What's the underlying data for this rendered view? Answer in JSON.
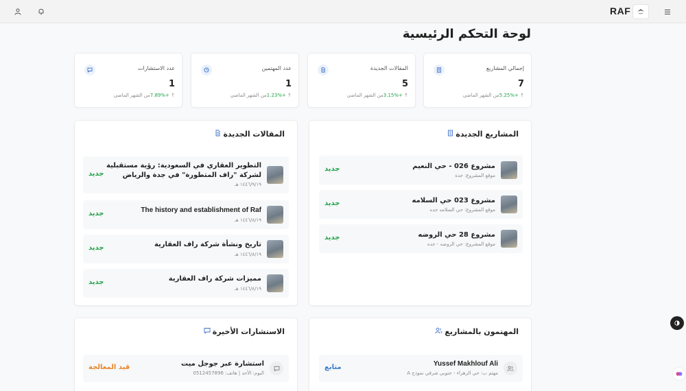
{
  "header": {
    "brand": "RAF",
    "menu_icon": "hamburger-icon",
    "bell_icon": "bell-icon",
    "user_icon": "user-icon"
  },
  "page_title": "لوحة التحكم الرئيسية",
  "stats": [
    {
      "label": "إجمالي المشاريع",
      "value": "7",
      "change": "+5.25%",
      "suffix": "من الشهر الماضي",
      "icon": "building-icon"
    },
    {
      "label": "المقالات الجديدة",
      "value": "5",
      "change": "+3.15%",
      "suffix": "من الشهر الماضي",
      "icon": "document-icon"
    },
    {
      "label": "عدد المهتمين",
      "value": "1",
      "change": "+1.23%",
      "suffix": "من الشهر الماضي",
      "icon": "clock-icon"
    },
    {
      "label": "عدد الاستشارات",
      "value": "1",
      "change": "+7.89%",
      "suffix": "من الشهر الماضي",
      "icon": "chat-icon"
    }
  ],
  "projects": {
    "title": "المشاريع الجديدة",
    "items": [
      {
        "title": "مشروع 026 - حي النعيم",
        "sub": "موقع المشروع: جدة",
        "tag": "جديد"
      },
      {
        "title": "مشروع 023 حي السلامه",
        "sub": "موقع المشروع: حي السلامه جده",
        "tag": "جديد"
      },
      {
        "title": "مشروع 28 حي الروضه",
        "sub": "موقع المشروع: حي الروضه - جده",
        "tag": "جديد"
      }
    ]
  },
  "articles": {
    "title": "المقالات الجديدة",
    "items": [
      {
        "title": "التطوير العقاري في السعودية: رؤية مستقبلية لشركة \"راف المتطورة\" في جدة والرياض",
        "sub": "١٤٤٦/٩/١٩ هـ",
        "tag": "جديد"
      },
      {
        "title": "The history and establishment of Raf",
        "sub": "١٤٤٦/٨/١٩ هـ",
        "tag": "جديد"
      },
      {
        "title": "تاريخ ونشأة شركة راف العقارية",
        "sub": "١٤٤٦/٨/١٩ هـ",
        "tag": "جديد"
      },
      {
        "title": "مميزات شركة راف العقارية",
        "sub": "١٤٤٦/٨/١٩ هـ",
        "tag": "جديد"
      }
    ]
  },
  "interested": {
    "title": "المهتمون بالمشاريع",
    "items": [
      {
        "name": "Yussef Makhlouf Ali",
        "sub": "مهتم ب: حي الزهراء - جنوبي شرقي نموذج A",
        "tag": "متابع"
      }
    ]
  },
  "consultations": {
    "title": "الاستشارات الأخيرة",
    "items": [
      {
        "title": "استشارة عبر جوجل ميت",
        "sub": "اليوم: الأحد | هاتف: 0512457896",
        "tag": "قيد المعالجة"
      }
    ]
  },
  "colors": {
    "green": "#22a34a",
    "orange": "#e8872b",
    "blue": "#3b7ac7",
    "accent": "#3b6fc7"
  }
}
